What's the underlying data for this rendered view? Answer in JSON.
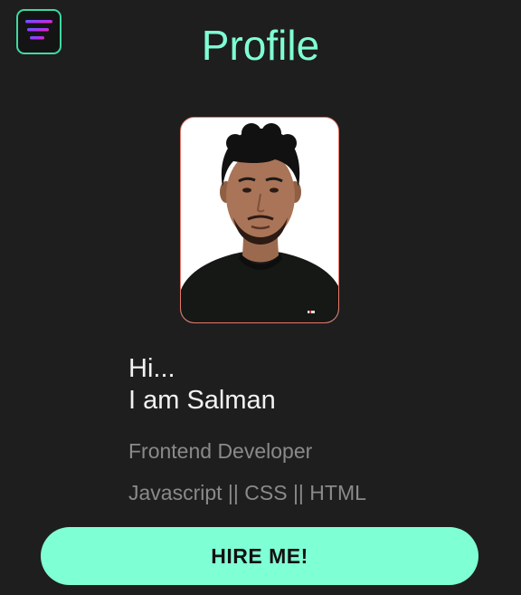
{
  "header": {
    "title": "Profile",
    "menu_icon": "hamburger-menu-icon"
  },
  "profile": {
    "photo_icon": "profile-photo",
    "greeting_line1": "Hi...",
    "greeting_line2": "I am Salman",
    "role": "Frontend Developer",
    "skills": "Javascript || CSS || HTML"
  },
  "actions": {
    "hire_label": "HIRE ME!"
  },
  "colors": {
    "background": "#1e1e1e",
    "accent": "#7fffd4",
    "menu_border": "#3fd9a0",
    "photo_border": "#e8776a",
    "menu_gradient_start": "#4a6cff",
    "menu_gradient_end": "#ff2a8a"
  }
}
